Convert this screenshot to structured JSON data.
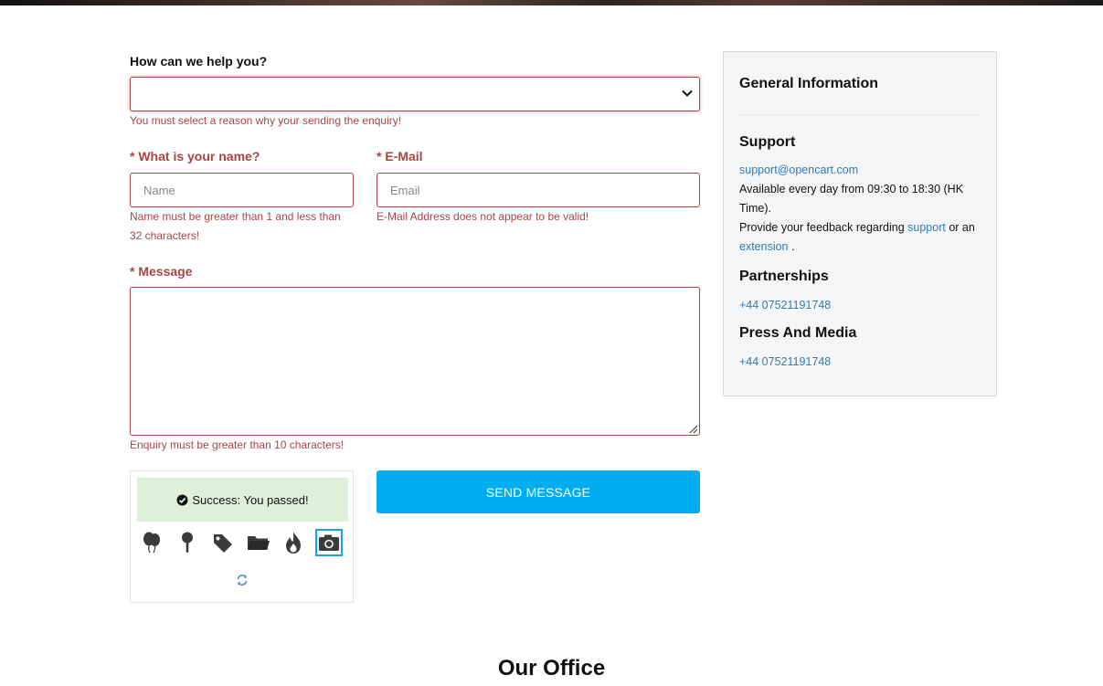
{
  "form": {
    "help_label": "How can we help you?",
    "help_select_value": "",
    "help_error": "You must select a reason why your sending the enquiry!",
    "required_mark": "*",
    "name_label": "What is your name?",
    "name_placeholder": "Name",
    "name_value": "",
    "name_error_line1": "Name must be greater than 1 and less than",
    "name_error_line2": "32 characters!",
    "email_label": "E-Mail",
    "email_placeholder": "Email",
    "email_value": "",
    "email_error": "E-Mail Address does not appear to be valid!",
    "message_label": "Message",
    "message_value": "",
    "message_error": "Enquiry must be greater than 10 characters!",
    "send_label": "SEND MESSAGE"
  },
  "captcha": {
    "success_text": "Success: You passed!",
    "icons": [
      "balloons-icon",
      "pin-icon",
      "tag-icon",
      "folder-icon",
      "fire-icon",
      "camera-icon"
    ],
    "selected_icon": "camera-icon"
  },
  "info": {
    "title": "General Information",
    "support_title": "Support",
    "support_email": "support@opencart.com",
    "availability": "Available every day from 09:30 to 18:30 (HK Time).",
    "feedback_prefix": "Provide your feedback regarding",
    "feedback_link_support": "support",
    "feedback_or": "or an",
    "feedback_link_extension": "extension",
    "feedback_suffix": ".",
    "partnerships_title": "Partnerships",
    "partnerships_phone": "+44 07521191748",
    "press_title": "Press And Media",
    "press_phone": "+44 07521191748"
  },
  "office": {
    "title": "Our Office"
  },
  "colors": {
    "error": "#a94442",
    "primary_button": "#00adee",
    "link": "#337ab7",
    "success_bg": "#dff0d8",
    "panel_bg": "#f4f5f7"
  }
}
